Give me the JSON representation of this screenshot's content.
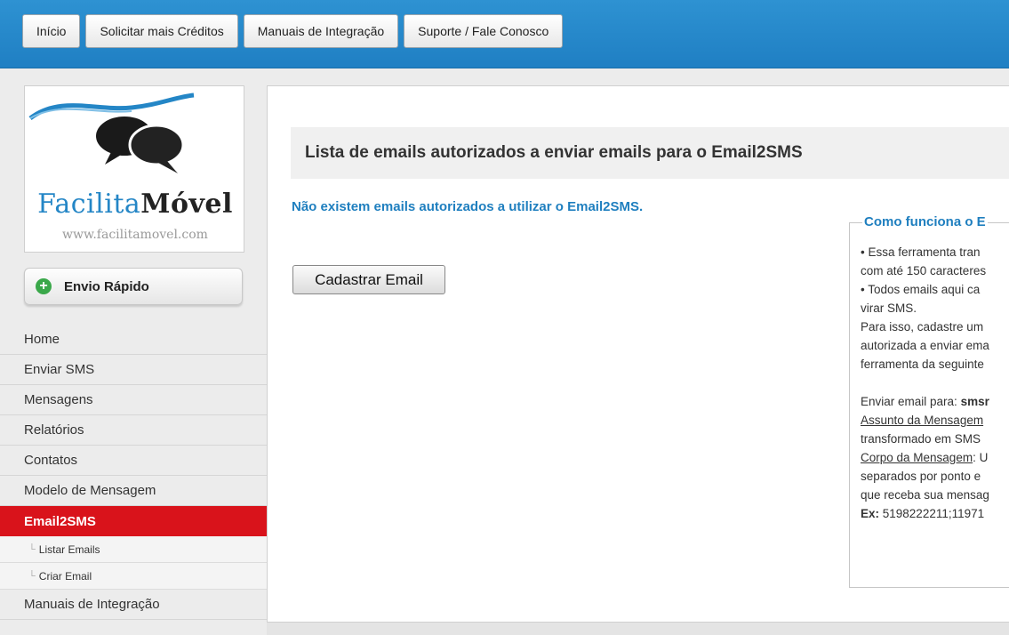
{
  "top_nav": [
    "Início",
    "Solicitar mais Créditos",
    "Manuais de Integração",
    "Suporte / Fale Conosco"
  ],
  "logo": {
    "brand_part1": "Facilita",
    "brand_part2": "Móvel",
    "url": "www.facilitamovel.com"
  },
  "quick_send": {
    "label": "Envio Rápido",
    "icon": "plus-circle-icon"
  },
  "sidebar_menu": {
    "home": "Home",
    "enviar_sms": "Enviar SMS",
    "mensagens": "Mensagens",
    "relatorios": "Relatórios",
    "contatos": "Contatos",
    "modelo": "Modelo de Mensagem",
    "email2sms": "Email2SMS",
    "sub_listar": "Listar Emails",
    "sub_criar": "Criar Email",
    "manuais": "Manuais de Integração"
  },
  "main": {
    "title": "Lista de emails autorizados a enviar emails para o Email2SMS",
    "notice": "Não existem emails autorizados a utilizar o Email2SMS.",
    "button": "Cadastrar Email"
  },
  "help_box": {
    "legend": "Como funciona o E",
    "lines": {
      "l1": "• Essa ferramenta tran",
      "l2": "com até 150 caracteres",
      "l3": "• Todos emails aqui ca",
      "l4": "virar SMS.",
      "l5": "Para isso, cadastre um",
      "l6": "autorizada a enviar ema",
      "l7": "ferramenta da seguinte",
      "l8_prefix": "Enviar email para: ",
      "l8_bold": "smsr",
      "l9_u": "Assunto da Mensagem",
      "l10": "transformado em SMS",
      "l11_u": "Corpo da Mensagem",
      "l11_rest": ": U",
      "l12": "separados por ponto e",
      "l13": "que receba sua mensag",
      "l14_bold": "Ex:",
      "l14_rest": " 5198222211;11971"
    }
  },
  "colors": {
    "top_bar": "#1f7fc3",
    "active_menu": "#d9131b",
    "link_blue": "#1f7fbf"
  }
}
